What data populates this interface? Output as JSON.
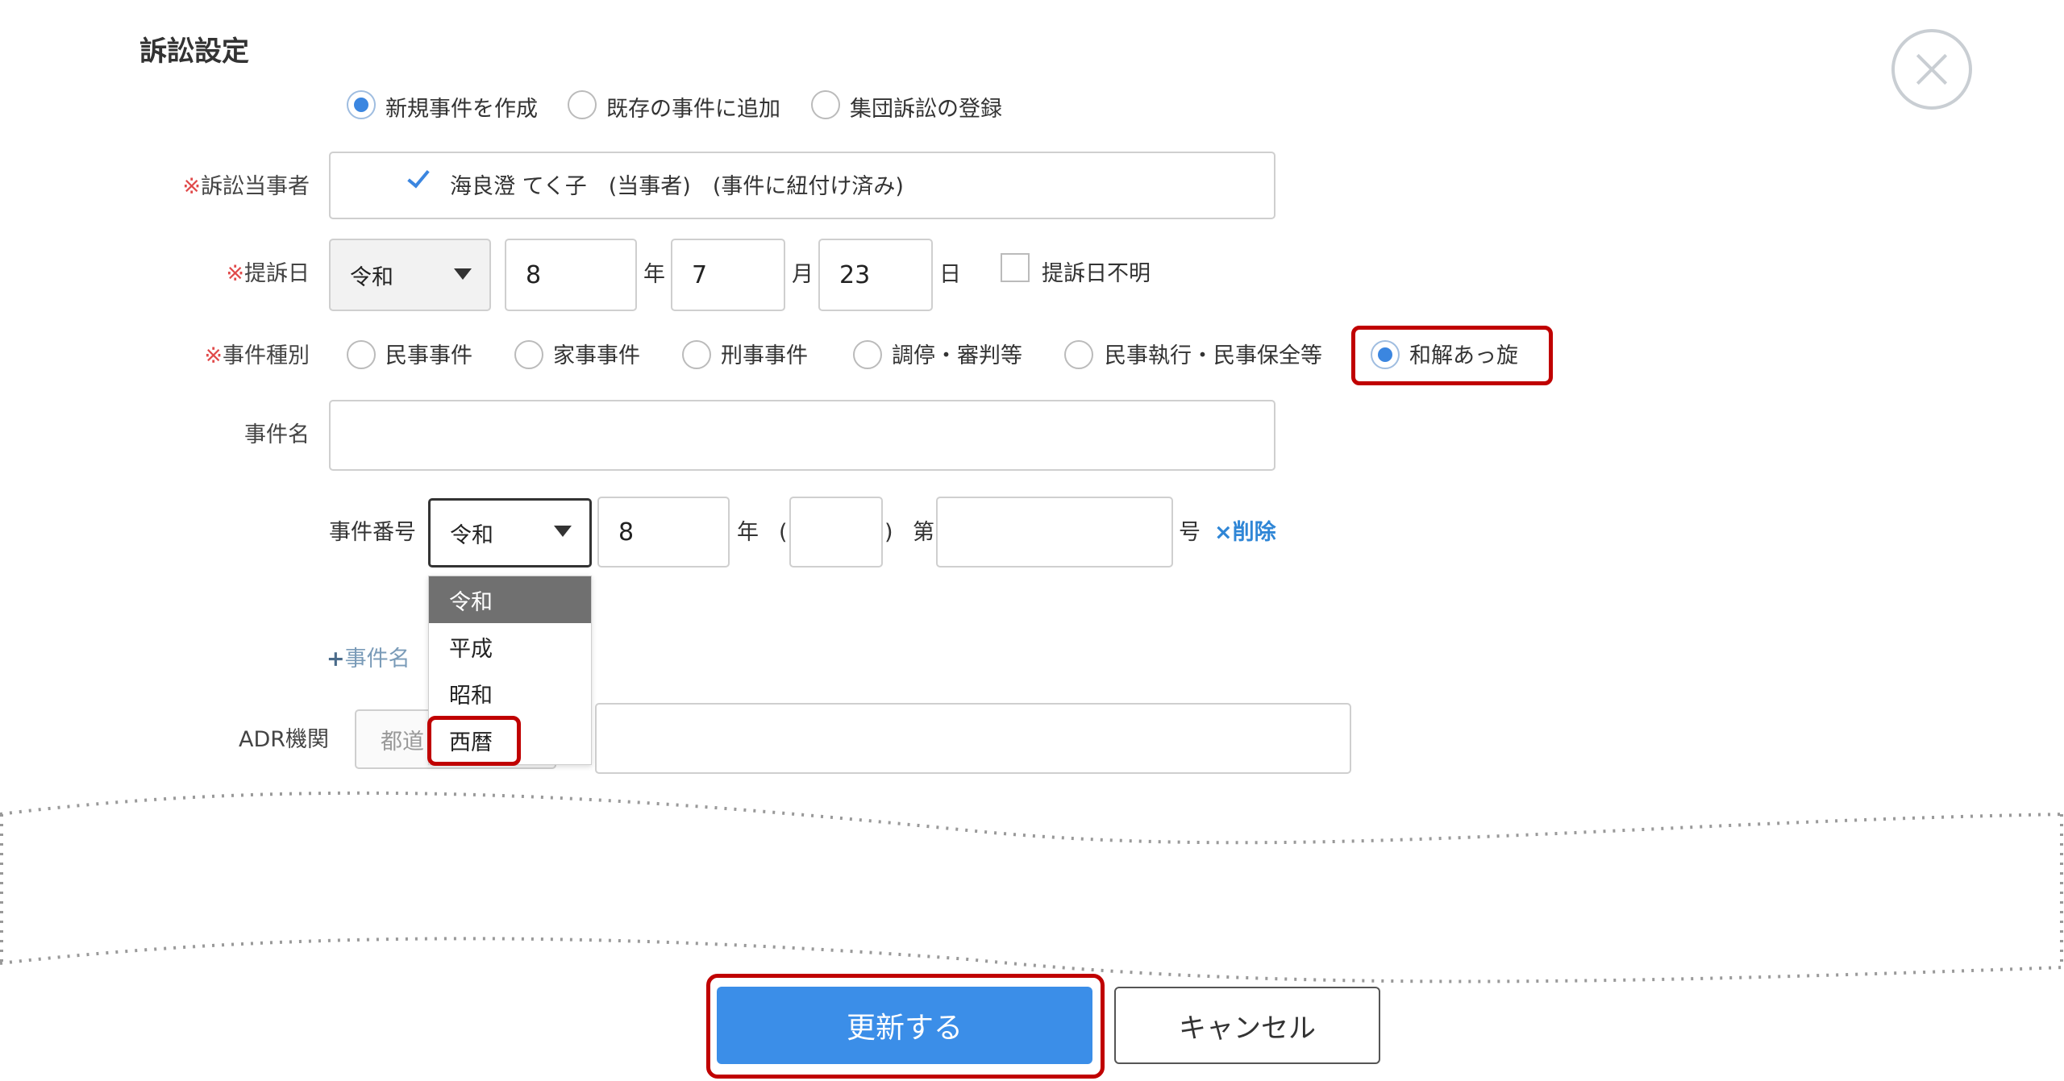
{
  "title": "訴訟設定",
  "mode_options": [
    {
      "label": "新規事件を作成",
      "checked": true
    },
    {
      "label": "既存の事件に追加",
      "checked": false
    },
    {
      "label": "集団訴訟の登録",
      "checked": false
    }
  ],
  "parties": {
    "label": "訴訟当事者",
    "required_mark": "※",
    "item_text": "海良澄 てく子　(当事者)　(事件に紐付け済み)",
    "checked": true
  },
  "filing_date": {
    "label": "提訴日",
    "required_mark": "※",
    "era": "令和",
    "year": "8",
    "year_unit": "年",
    "month": "7",
    "month_unit": "月",
    "day": "23",
    "day_unit": "日",
    "unknown_label": "提訴日不明",
    "unknown_checked": false
  },
  "case_type": {
    "label": "事件種別",
    "required_mark": "※",
    "options": [
      {
        "label": "民事事件",
        "checked": false
      },
      {
        "label": "家事事件",
        "checked": false
      },
      {
        "label": "刑事事件",
        "checked": false
      },
      {
        "label": "調停・審判等",
        "checked": false
      },
      {
        "label": "民事執行・民事保全等",
        "checked": false
      },
      {
        "label": "和解あっ旋",
        "checked": true
      }
    ]
  },
  "case_name": {
    "label": "事件名",
    "value": ""
  },
  "case_number": {
    "label": "事件番号",
    "era": "令和",
    "year": "8",
    "year_unit": "年",
    "paren_open": "(",
    "code": "",
    "paren_close": ")",
    "prefix": "第",
    "number": "",
    "suffix": "号",
    "delete_icon": "×",
    "delete_label": "削除"
  },
  "era_dropdown": {
    "options": [
      "令和",
      "平成",
      "昭和",
      "西暦"
    ],
    "highlighted": "令和"
  },
  "add_case_name": {
    "icon": "+",
    "label": "事件名"
  },
  "adr": {
    "label": "ADR機関",
    "prefecture_placeholder": "都道",
    "value": ""
  },
  "buttons": {
    "update": "更新する",
    "cancel": "キャンセル"
  },
  "colors": {
    "accent": "#3b8ee8",
    "annotation": "#c00000",
    "required": "#e04a4a",
    "link": "#2f86d6"
  }
}
